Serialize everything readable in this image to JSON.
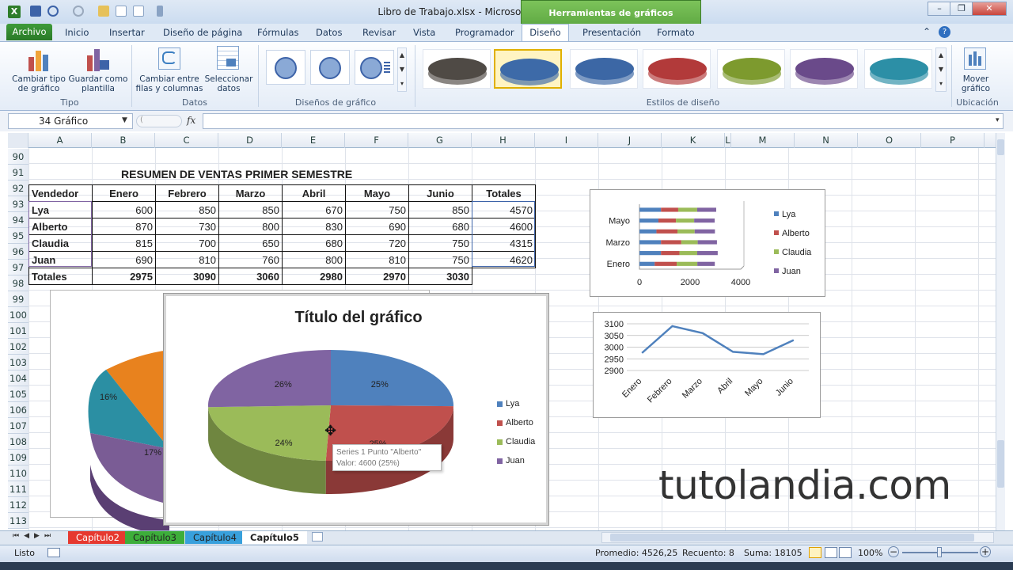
{
  "window": {
    "title": "Libro de Trabajo.xlsx - Microsoft Excel",
    "context_tab": "Herramientas de gráficos"
  },
  "tabs": [
    "Archivo",
    "Inicio",
    "Insertar",
    "Diseño de página",
    "Fórmulas",
    "Datos",
    "Revisar",
    "Vista",
    "Programador",
    "Diseño",
    "Presentación",
    "Formato"
  ],
  "ribbon": {
    "btn_change_type": "Cambiar tipo\nde gráfico",
    "btn_save_template": "Guardar como\nplantilla",
    "grp_tipo": "Tipo",
    "btn_switch": "Cambiar entre\nfilas y columnas",
    "btn_select": "Seleccionar\ndatos",
    "grp_datos": "Datos",
    "grp_layouts": "Diseños de gráfico",
    "grp_styles": "Estilos de diseño",
    "btn_move": "Mover\ngráfico",
    "grp_ubicacion": "Ubicación"
  },
  "style_colors": [
    "#4f4a45",
    "#3d6aa8",
    "#3c67a5",
    "#b23a3a",
    "#7d9a2e",
    "#6a4a8a",
    "#2c8fa6"
  ],
  "formula_bar": {
    "name_box": "34 Gráfico",
    "fx": "fx"
  },
  "columns": [
    "A",
    "B",
    "C",
    "D",
    "E",
    "F",
    "G",
    "H",
    "I",
    "J",
    "K",
    "L",
    "M",
    "N",
    "O",
    "P"
  ],
  "rows": [
    "90",
    "91",
    "92",
    "93",
    "94",
    "95",
    "96",
    "97",
    "98",
    "99",
    "100",
    "101",
    "102",
    "103",
    "104",
    "105",
    "106",
    "107",
    "108",
    "109",
    "110",
    "111",
    "112",
    "113"
  ],
  "sheet": {
    "title": "RESUMEN DE VENTAS PRIMER SEMESTRE",
    "headers": [
      "Vendedor",
      "Enero",
      "Febrero",
      "Marzo",
      "Abril",
      "Mayo",
      "Junio",
      "Totales"
    ],
    "data": [
      [
        "Lya",
        "600",
        "850",
        "850",
        "670",
        "750",
        "850",
        "4570"
      ],
      [
        "Alberto",
        "870",
        "730",
        "800",
        "830",
        "690",
        "680",
        "4600"
      ],
      [
        "Claudia",
        "815",
        "700",
        "650",
        "680",
        "720",
        "750",
        "4315"
      ],
      [
        "Juan",
        "690",
        "810",
        "760",
        "800",
        "810",
        "750",
        "4620"
      ],
      [
        "Totales",
        "2975",
        "3090",
        "3060",
        "2980",
        "2970",
        "3030",
        ""
      ]
    ]
  },
  "pie_chart": {
    "title": "Título del gráfico",
    "legend": [
      "Lya",
      "Alberto",
      "Claudia",
      "Juan"
    ],
    "labels": [
      "25%",
      "25%",
      "24%",
      "26%"
    ],
    "tooltip_line1": "Series 1 Punto \"Alberto\"",
    "tooltip_line2": "Valor: 4600 (25%)"
  },
  "back_pie": {
    "labels": [
      "16%",
      "17%"
    ]
  },
  "bar_chart": {
    "categories": [
      "Mayo",
      "Marzo",
      "Enero"
    ],
    "ticks": [
      "0",
      "2000",
      "4000"
    ],
    "legend": [
      "Lya",
      "Alberto",
      "Claudia",
      "Juan"
    ]
  },
  "line_chart": {
    "y_ticks": [
      "3100",
      "3050",
      "3000",
      "2950",
      "2900"
    ],
    "x_labels": [
      "Enero",
      "Febrero",
      "Marzo",
      "Abril",
      "Mayo",
      "Junio"
    ]
  },
  "colors": {
    "lya": "#4f81bd",
    "alberto": "#c0504d",
    "claudia": "#9bbb59",
    "juan": "#8064a2",
    "excel_green": "#2e7d2a"
  },
  "chart_data": [
    {
      "type": "pie",
      "title": "Título del gráfico",
      "categories": [
        "Lya",
        "Alberto",
        "Claudia",
        "Juan"
      ],
      "values": [
        4570,
        4600,
        4315,
        4620
      ],
      "data_labels": [
        "25%",
        "25%",
        "24%",
        "26%"
      ]
    },
    {
      "type": "bar",
      "categories": [
        "Enero",
        "Febrero",
        "Marzo",
        "Abril",
        "Mayo",
        "Junio"
      ],
      "series": [
        {
          "name": "Lya",
          "values": [
            600,
            850,
            850,
            670,
            750,
            850
          ]
        },
        {
          "name": "Alberto",
          "values": [
            870,
            730,
            800,
            830,
            690,
            680
          ]
        },
        {
          "name": "Claudia",
          "values": [
            815,
            700,
            650,
            680,
            720,
            750
          ]
        },
        {
          "name": "Juan",
          "values": [
            690,
            810,
            760,
            800,
            810,
            750
          ]
        }
      ],
      "xlim": [
        0,
        4000
      ]
    },
    {
      "type": "line",
      "categories": [
        "Enero",
        "Febrero",
        "Marzo",
        "Abril",
        "Mayo",
        "Junio"
      ],
      "values": [
        2975,
        3090,
        3060,
        2980,
        2970,
        3030
      ],
      "ylim": [
        2900,
        3100
      ]
    }
  ],
  "sheet_tabs": [
    "Capítulo2",
    "Capítulo3",
    "Capítulo4",
    "Capítulo5"
  ],
  "status": {
    "ready": "Listo",
    "avg": "Promedio: 4526,25",
    "count": "Recuento: 8",
    "sum": "Suma: 18105",
    "zoom": "100%"
  },
  "watermark": "tutolandia.com"
}
